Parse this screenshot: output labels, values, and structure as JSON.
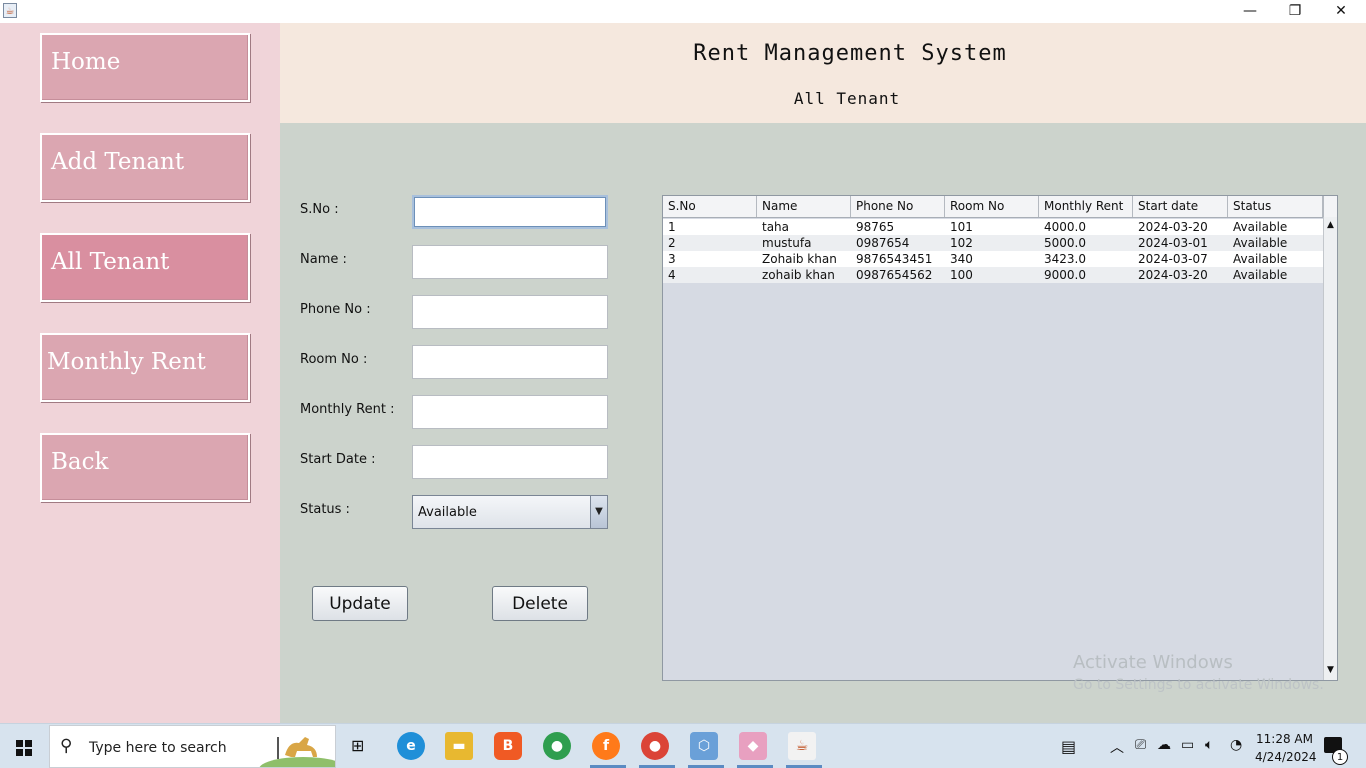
{
  "window": {
    "icon": "java-icon",
    "controls": {
      "minimize": "—",
      "restore": "❐",
      "close": "✕"
    }
  },
  "sidebar": {
    "items": [
      {
        "label": "Home"
      },
      {
        "label": "Add Tenant"
      },
      {
        "label": "All Tenant"
      },
      {
        "label": "Monthly Rent"
      },
      {
        "label": "Back"
      }
    ]
  },
  "header": {
    "title": "Rent Management System",
    "subtitle": "All Tenant"
  },
  "form": {
    "sno_label": "S.No :",
    "name_label": "Name :",
    "phone_label": "Phone No :",
    "room_label": "Room No :",
    "rent_label": "Monthly Rent :",
    "start_label": "Start Date :",
    "status_label": "Status :",
    "status_value": "Available",
    "sno_value": "",
    "name_value": "",
    "phone_value": "",
    "room_value": "",
    "rent_value": "",
    "start_value": "",
    "update_label": "Update",
    "delete_label": "Delete"
  },
  "table": {
    "headers": [
      "S.No",
      "Name",
      "Phone No",
      "Room  No",
      "Monthly Rent",
      "Start date",
      "Status"
    ],
    "rows": [
      [
        "1",
        "taha",
        "98765",
        "101",
        "4000.0",
        "2024-03-20",
        "Available"
      ],
      [
        "2",
        "mustufa",
        "0987654",
        "102",
        "5000.0",
        "2024-03-01",
        "Available"
      ],
      [
        "3",
        "Zohaib khan",
        "9876543451",
        "340",
        "3423.0",
        "2024-03-07",
        "Available"
      ],
      [
        "4",
        "zohaib khan",
        "0987654562",
        "100",
        "9000.0",
        "2024-03-20",
        "Available"
      ]
    ]
  },
  "watermark": {
    "line1": "Activate Windows",
    "line2": "Go to Settings to activate Windows."
  },
  "taskbar": {
    "search_placeholder": "Type here to search",
    "time": "11:28 AM",
    "date": "4/24/2024",
    "notification_count": "1",
    "apps": [
      "task-view-icon",
      "edge-icon",
      "file-explorer-icon",
      "brave-icon",
      "chrome-icon",
      "firefox-icon",
      "chrome-profile-icon",
      "netbeans-icon",
      "git-icon",
      "java-icon"
    ]
  },
  "colors": {
    "sidebar_bg": "#f0d4d9",
    "nav_button": "#dba6b1",
    "nav_active": "#d98fa0",
    "header_bg": "#f5e8de",
    "content_bg": "#ccd3cc",
    "taskbar_bg": "#d7e3ee"
  }
}
